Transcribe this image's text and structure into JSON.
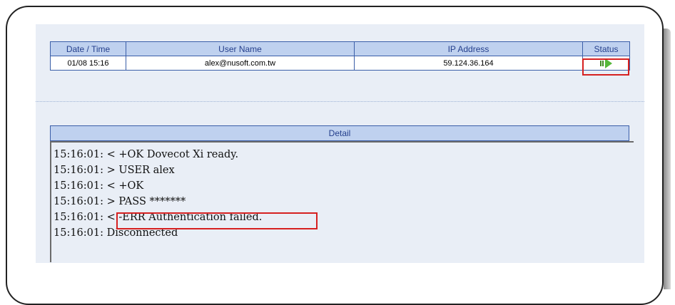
{
  "log_table": {
    "headers": [
      "Date / Time",
      "User Name",
      "IP Address",
      "Status"
    ],
    "row": {
      "datetime": "01/08 15:16",
      "user": "alex@nusoft.com.tw",
      "ip": "59.124.36.164",
      "status_icon": "play-status-icon"
    }
  },
  "detail": {
    "title": "Detail",
    "lines": [
      "15:16:01: < +OK Dovecot Xi ready.",
      "15:16:01: > USER alex",
      "15:16:01: < +OK",
      "15:16:01: > PASS *******",
      "15:16:01: < -ERR Authentication failed.",
      "15:16:01: Disconnected"
    ]
  },
  "colors": {
    "header_bg": "#bfd1ef",
    "header_text": "#243f8c",
    "border": "#3a5ea8",
    "highlight": "#d62020",
    "panel_bg": "#e9eef6",
    "status_green": "#55b83a"
  }
}
